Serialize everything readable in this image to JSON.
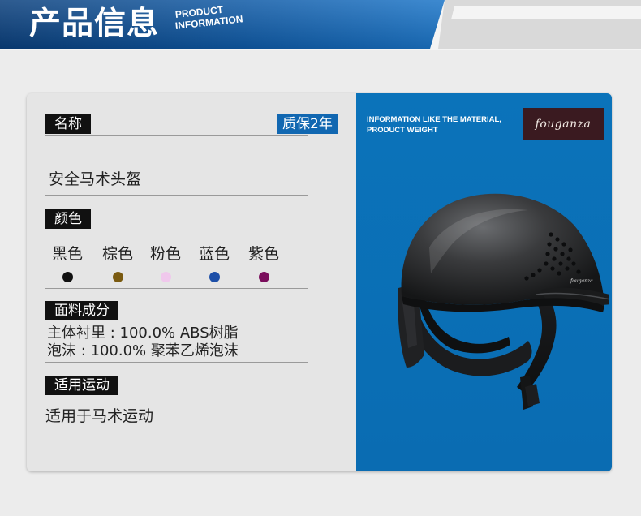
{
  "header": {
    "title": "产品信息",
    "subtitle_line1": "PRODUCT",
    "subtitle_line2": "INFORMATION"
  },
  "product": {
    "name_label": "名称",
    "warranty": "质保2年",
    "name": "安全马术头盔",
    "color_label": "颜色",
    "colors": [
      {
        "name": "黑色",
        "swatch": "#111111"
      },
      {
        "name": "棕色",
        "swatch": "#7a5a10"
      },
      {
        "name": "粉色",
        "swatch": "#f0c8ec"
      },
      {
        "name": "蓝色",
        "swatch": "#1d4fa8"
      },
      {
        "name": "紫色",
        "swatch": "#7a0e5c"
      }
    ],
    "material_label": "面料成分",
    "materials": [
      "主体衬里 : 100.0% ABS树脂",
      " 泡沫 : 100.0% 聚苯乙烯泡沫"
    ],
    "usage_label": "适用运动",
    "usage": "适用于马术运动"
  },
  "panel": {
    "info_line1": "INFORMATION LIKE THE MATERIAL,",
    "info_line2": "PRODUCT WEIGHT",
    "brand": "fouganza",
    "helmet_brand": "fouganza"
  },
  "colors": {
    "accent_blue": "#0b73ba",
    "label_bg": "#111111"
  }
}
